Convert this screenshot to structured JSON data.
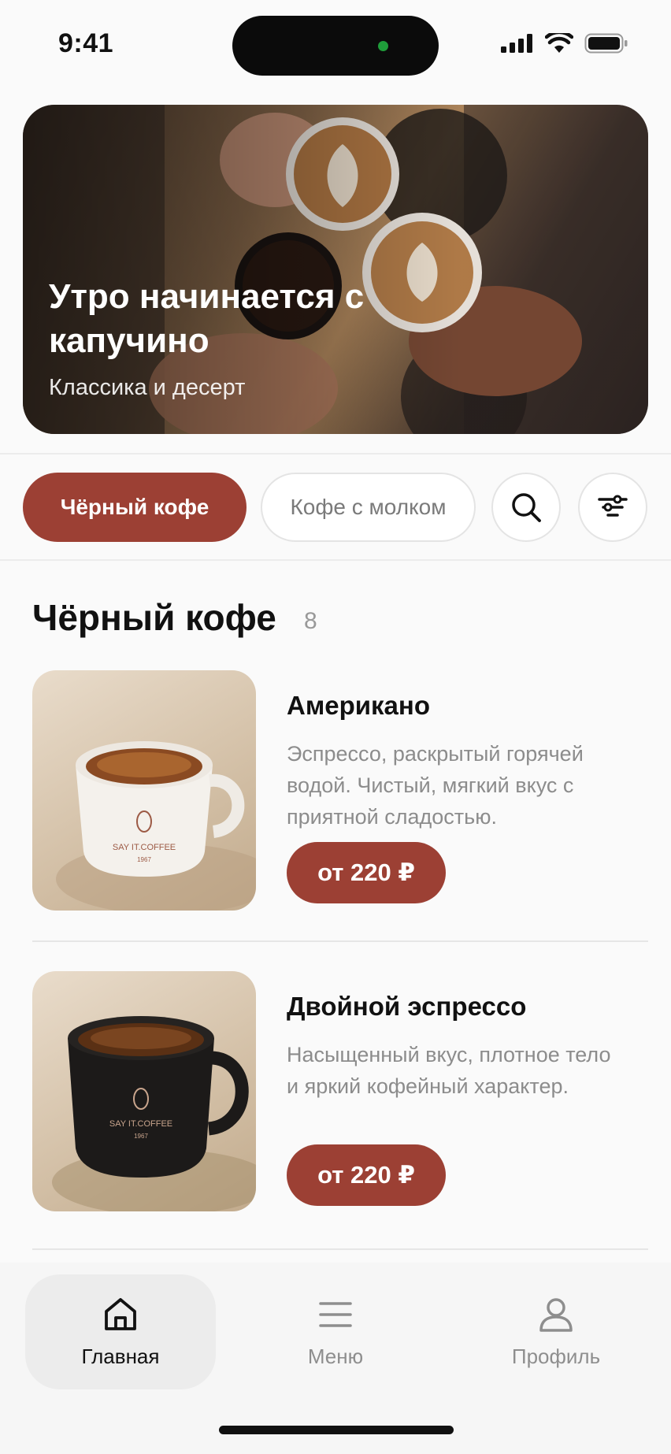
{
  "status_bar": {
    "time": "9:41"
  },
  "hero": {
    "title": "Утро начинается с капучино",
    "subtitle": "Классика и десерт"
  },
  "filters": {
    "active_chip": "Чёрный кофе",
    "inactive_chip": "Кофе с молком",
    "search_icon": "search-icon",
    "filter_icon": "filter-icon"
  },
  "section": {
    "title": "Чёрный кофе",
    "count": "8"
  },
  "products": [
    {
      "name": "Американо",
      "description": "Эспрессо, раскрытый горячей водой. Чистый, мягкий вкус с приятной сладостью.",
      "price": "от 220 ₽",
      "cup_brand": "SAY IT.COFFEE",
      "cup_year": "1967"
    },
    {
      "name": "Двойной эспрессо",
      "description": "Насыщенный вкус, плотное тело и яркий кофейный характер.",
      "price": "от 220 ₽",
      "cup_brand": "SAY IT.COFFEE",
      "cup_year": "1967"
    }
  ],
  "tab_bar": {
    "home": "Главная",
    "menu": "Меню",
    "profile": "Профиль"
  },
  "colors": {
    "accent": "#9c4034",
    "background": "#fafafa"
  }
}
